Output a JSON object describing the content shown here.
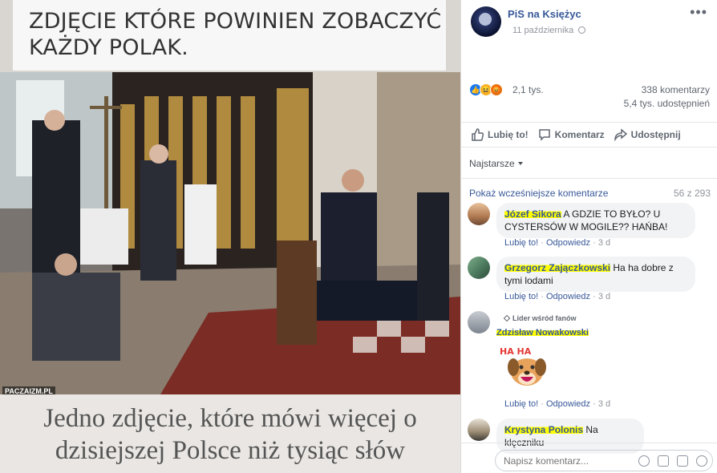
{
  "meme": {
    "title": "ZDJĘCIE KTÓRE POWINIEN ZOBACZYĆ KAŻDY POLAK.",
    "caption": "Jedno zdjęcie, które mówi więcej o dzisiejszej Polsce niż tysiąc słów",
    "watermark": "PACZAIZM.PL"
  },
  "post": {
    "page_name": "PiS na Księżyc",
    "date": "11 października",
    "more": "•••"
  },
  "stats": {
    "reactions_count": "2,1 tys.",
    "comments": "338 komentarzy",
    "shares": "5,4 tys. udostępnień"
  },
  "actions": {
    "like": "Lubię to!",
    "comment": "Komentarz",
    "share": "Udostępnij"
  },
  "sort_label": "Najstarsze",
  "prev_comments": "Pokaż wcześniejsze komentarze",
  "prev_count": "56 z 293",
  "comments": [
    {
      "name": "Józef Sikora",
      "text": "A GDZIE TO BYŁO? U CYSTERSÓW W MOGILE?? HAŃBA!",
      "like": "Lubię to!",
      "reply": "Odpowiedz",
      "time": "3 d"
    },
    {
      "name": "Grzegorz Zajączkowski",
      "text": "Ha ha dobre z tymi lodami",
      "like": "Lubię to!",
      "reply": "Odpowiedz",
      "time": "3 d"
    },
    {
      "badge": "Lider wśród fanów",
      "name": "Zdzisław Nowakowski",
      "sticker_text": "HA HA",
      "like": "Lubię to!",
      "reply": "Odpowiedz",
      "time": "3 d"
    },
    {
      "name": "Krystyna Polonis",
      "text": "Na klęczniku"
    }
  ],
  "composer": {
    "placeholder": "Napisz komentarz..."
  }
}
